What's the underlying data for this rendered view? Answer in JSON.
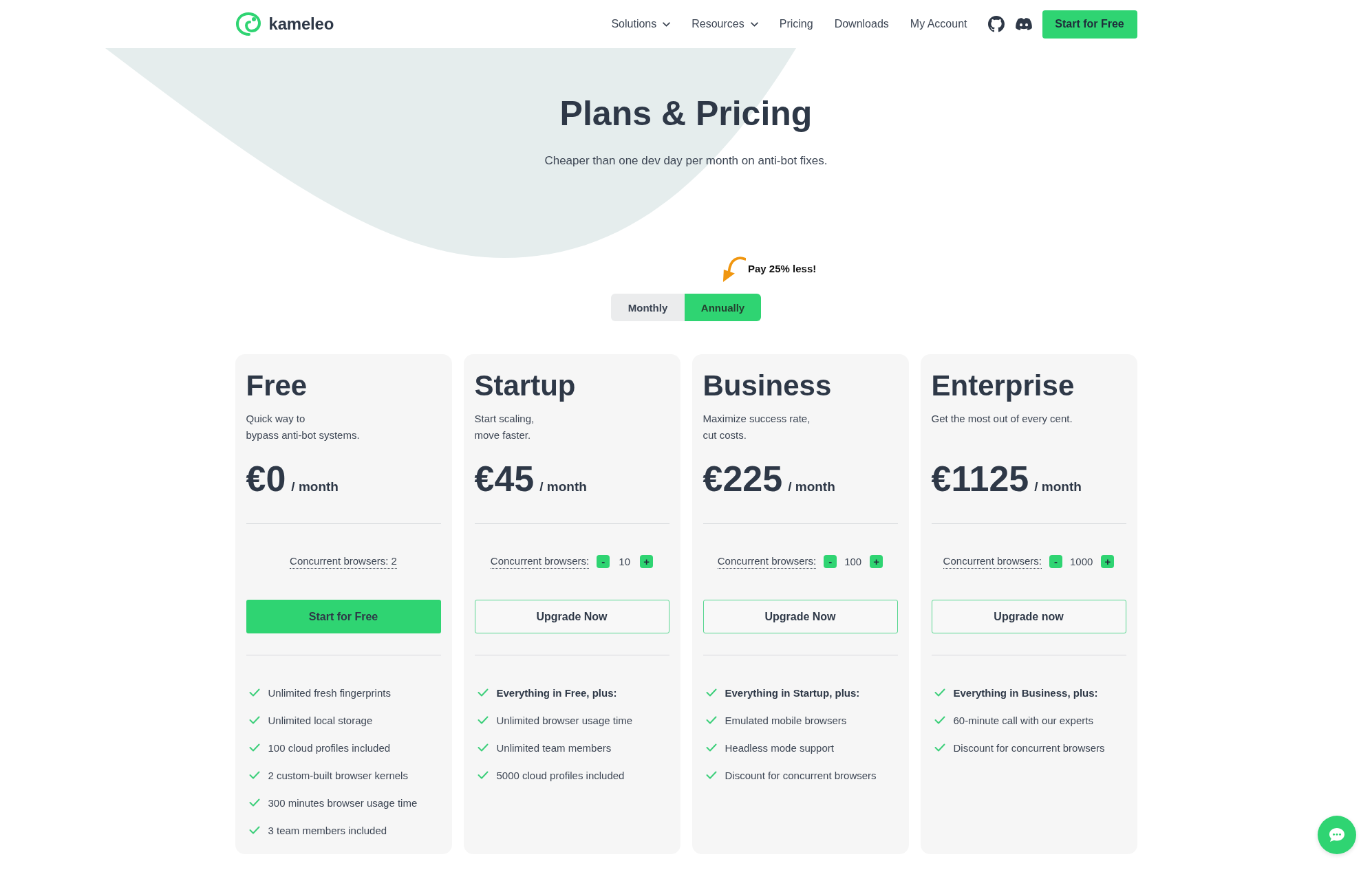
{
  "header": {
    "logo_text": "kameleo",
    "nav": [
      {
        "label": "Solutions",
        "kind": "dropdown"
      },
      {
        "label": "Resources",
        "kind": "dropdown"
      },
      {
        "label": "Pricing",
        "kind": "link"
      },
      {
        "label": "Downloads",
        "kind": "link"
      },
      {
        "label": "My Account",
        "kind": "link"
      }
    ],
    "cta": "Start for Free"
  },
  "hero": {
    "title": "Plans & Pricing",
    "subtitle": "Cheaper than one dev day per month on anti-bot fixes."
  },
  "billing": {
    "promo": "Pay 25% less!",
    "options": [
      {
        "label": "Monthly",
        "selected": false
      },
      {
        "label": "Annually",
        "selected": true
      }
    ]
  },
  "plans": [
    {
      "name": "Free",
      "description": "Quick way to\nbypass anti-bot systems.",
      "price": "€0",
      "period": "/ month",
      "browsers": {
        "kind": "fixed",
        "label": "Concurrent browsers: 2"
      },
      "button": {
        "kind": "primary",
        "label": "Start for Free"
      },
      "features": [
        {
          "text": "Unlimited fresh fingerprints",
          "bold": false
        },
        {
          "text": "Unlimited local storage",
          "bold": false
        },
        {
          "text": "100 cloud profiles included",
          "bold": false
        },
        {
          "text": "2 custom-built browser kernels",
          "bold": false
        },
        {
          "text": "300 minutes browser usage time",
          "bold": false
        },
        {
          "text": "3 team members included",
          "bold": false
        }
      ]
    },
    {
      "name": "Startup",
      "description": "Start scaling,\nmove faster.",
      "price": "€45",
      "period": "/ month",
      "browsers": {
        "kind": "stepper",
        "label": "Concurrent browsers:",
        "decrement": "-",
        "value": "10",
        "increment": "+"
      },
      "button": {
        "kind": "outline",
        "label": "Upgrade Now"
      },
      "features": [
        {
          "text": "Everything in Free, plus:",
          "bold": true
        },
        {
          "text": "Unlimited browser usage time",
          "bold": false
        },
        {
          "text": "Unlimited team members",
          "bold": false
        },
        {
          "text": "5000 cloud profiles included",
          "bold": false
        }
      ]
    },
    {
      "name": "Business",
      "description": "Maximize success rate,\ncut costs.",
      "price": "€225",
      "period": "/ month",
      "browsers": {
        "kind": "stepper",
        "label": "Concurrent browsers:",
        "decrement": "-",
        "value": "100",
        "increment": "+"
      },
      "button": {
        "kind": "outline",
        "label": "Upgrade Now"
      },
      "features": [
        {
          "text": "Everything in Startup, plus:",
          "bold": true
        },
        {
          "text": "Emulated mobile browsers",
          "bold": false
        },
        {
          "text": "Headless mode support",
          "bold": false
        },
        {
          "text": "Discount for concurrent browsers",
          "bold": false
        }
      ]
    },
    {
      "name": "Enterprise",
      "description": "Get the most out of every cent.",
      "price": "€1125",
      "period": "/ month",
      "browsers": {
        "kind": "stepper",
        "label": "Concurrent browsers:",
        "decrement": "-",
        "value": "1000",
        "increment": "+"
      },
      "button": {
        "kind": "outline",
        "label": "Upgrade now"
      },
      "features": [
        {
          "text": "Everything in Business, plus:",
          "bold": true
        },
        {
          "text": "60-minute call with our experts",
          "bold": false
        },
        {
          "text": "Discount for concurrent browsers",
          "bold": false
        }
      ]
    }
  ]
}
